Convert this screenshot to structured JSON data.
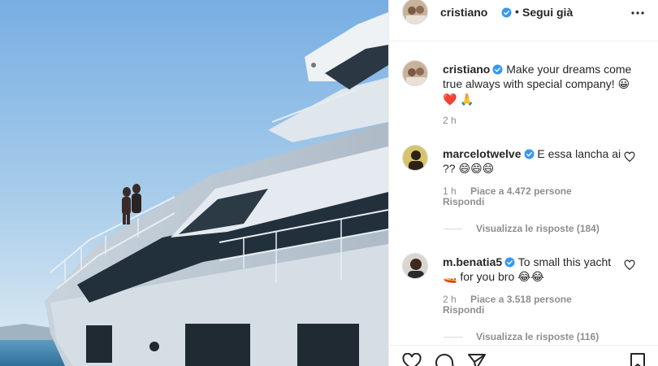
{
  "header": {
    "username": "cristiano",
    "separator": "•",
    "follow_status": "Segui già"
  },
  "caption": {
    "username": "cristiano",
    "text": "Make your dreams come true always with special company!",
    "emoji_smile": "😀",
    "emoji_heart": "❤️",
    "emoji_pray": "🙏",
    "time": "2 h"
  },
  "comments": [
    {
      "username": "marcelotwelve",
      "text": "E essa lancha ai ??",
      "emojis": "😄😄😄",
      "time": "1 h",
      "likes": "Piace a 4.472 persone",
      "reply_label": "Rispondi",
      "view_replies": "Visualizza le risposte (184)"
    },
    {
      "username": "m.benatia5",
      "text": "To small this yacht",
      "text2": "for you bro",
      "emoji_boat": "🚤",
      "emojis": "😂😂",
      "time": "2 h",
      "likes": "Piace a 3.518 persone",
      "reply_label": "Rispondi",
      "view_replies": "Visualizza le risposte (116)"
    }
  ],
  "colors": {
    "verified": "#3897f0",
    "secondary_text": "#8e8e8e",
    "divider": "#efefef",
    "sky_top": "#7fb4e6",
    "sky_bottom": "#dbe9f3",
    "sea": "#3d7ea6"
  },
  "icons": [
    "more-options-icon",
    "verified-icon",
    "heart-icon",
    "comment-icon",
    "share-icon",
    "bookmark-icon"
  ]
}
